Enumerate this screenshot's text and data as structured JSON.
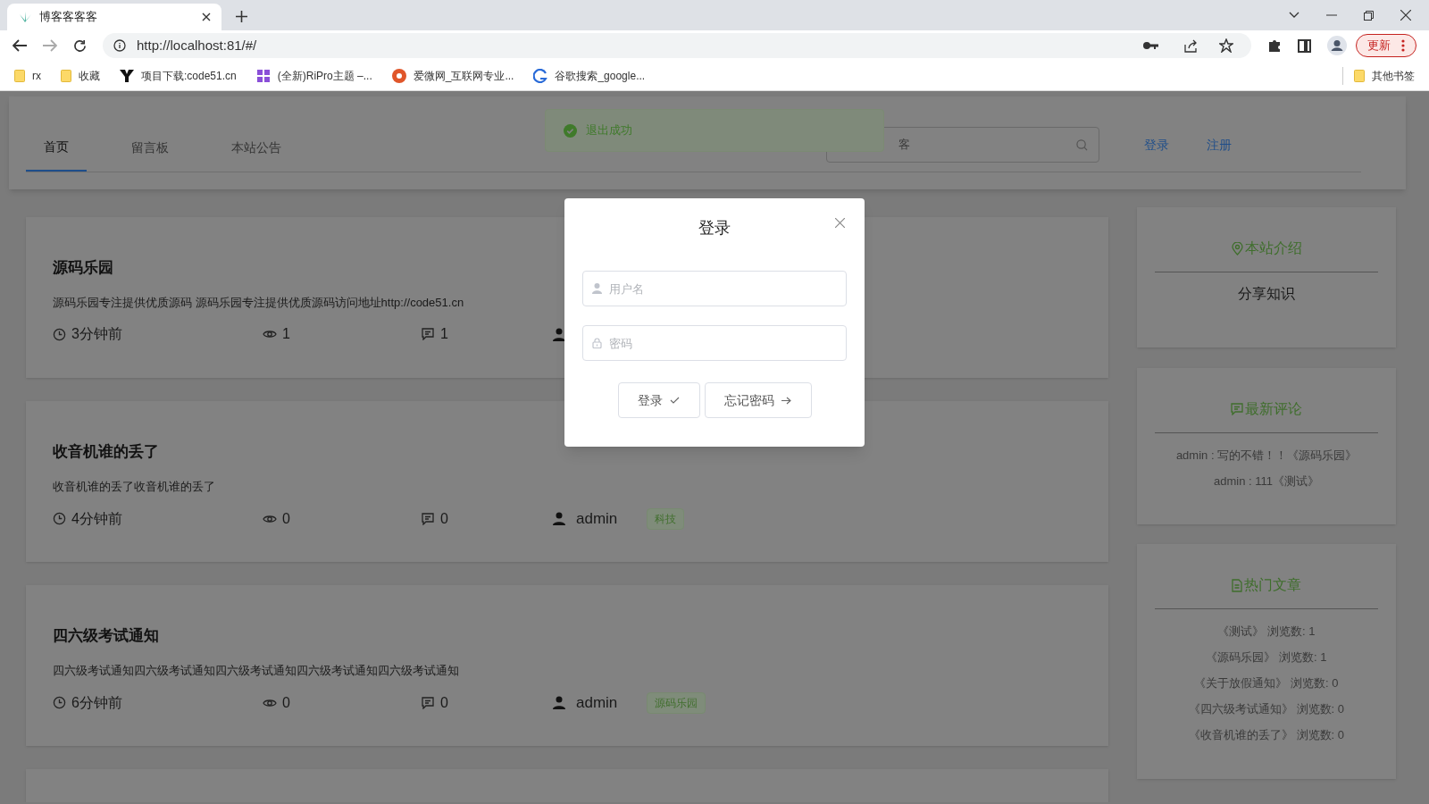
{
  "browser": {
    "tab_title": "博客客客客",
    "url": "http://localhost:81/#/",
    "update_label": "更新",
    "bookmarks": [
      {
        "label": "rx",
        "kind": "folder"
      },
      {
        "label": "收藏",
        "kind": "folder"
      },
      {
        "label": "项目下载:code51.cn",
        "kind": "y"
      },
      {
        "label": "(全新)RiPro主题 –...",
        "kind": "purple"
      },
      {
        "label": "爱微网_互联网专业...",
        "kind": "orange"
      },
      {
        "label": "谷歌搜索_google...",
        "kind": "blue"
      }
    ],
    "other_bookmarks": "其他书签"
  },
  "nav": {
    "tabs": [
      {
        "label": "首页",
        "selected": true
      },
      {
        "label": "留言板",
        "selected": false
      },
      {
        "label": "本站公告",
        "selected": false
      }
    ],
    "search_placeholder_visible": "客",
    "login": "登录",
    "register": "注册"
  },
  "toast": {
    "text": "退出成功"
  },
  "posts": [
    {
      "title": "源码乐园",
      "excerpt": "源码乐园专注提供优质源码 源码乐园专注提供优质源码访问地址http://code51.cn",
      "time": "3分钟前",
      "views": "1",
      "comments": "1"
    },
    {
      "title": "收音机谁的丢了",
      "excerpt": "收音机谁的丢了收音机谁的丢了",
      "time": "4分钟前",
      "views": "0",
      "comments": "0",
      "author": "admin",
      "tag": "科技"
    },
    {
      "title": "四六级考试通知",
      "excerpt": "四六级考试通知四六级考试通知四六级考试通知四六级考试通知四六级考试通知",
      "time": "6分钟前",
      "views": "0",
      "comments": "0",
      "author": "admin",
      "tag": "源码乐园"
    }
  ],
  "sidebar": [
    {
      "kind": "intro",
      "title": "本站介绍",
      "lines": [
        "分享知识"
      ]
    },
    {
      "kind": "comments",
      "title": "最新评论",
      "lines": [
        "admin : 写的不错！！《源码乐园》",
        "admin : 111《测试》"
      ]
    },
    {
      "kind": "hot",
      "title": "热门文章",
      "lines": [
        "《测试》 浏览数: 1",
        "《源码乐园》 浏览数: 1",
        "《关于放假通知》 浏览数: 0",
        "《四六级考试通知》 浏览数: 0",
        "《收音机谁的丢了》 浏览数: 0"
      ]
    }
  ],
  "dialog": {
    "title": "登录",
    "username_placeholder": "用户名",
    "password_placeholder": "密码",
    "login_button": "登录",
    "forgot_button": "忘记密码"
  }
}
